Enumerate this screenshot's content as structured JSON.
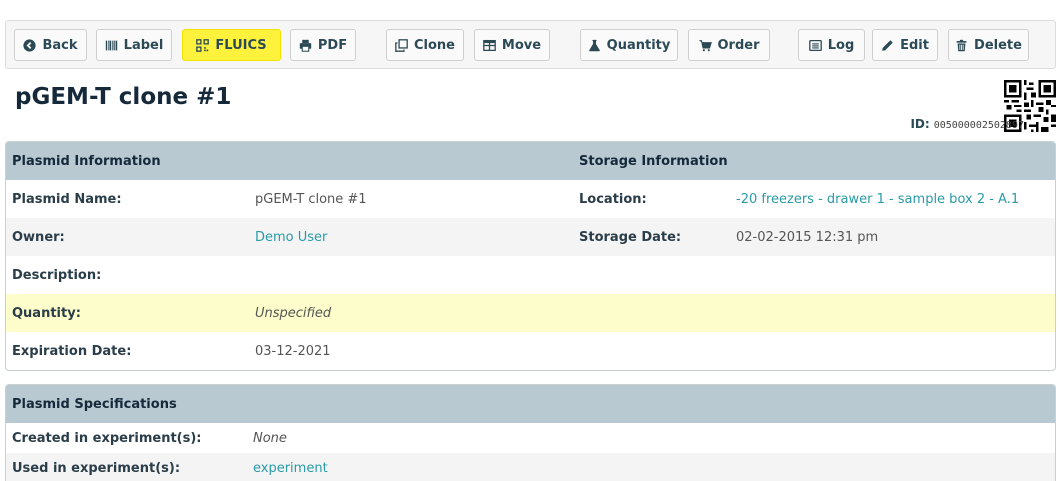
{
  "toolbar": {
    "back": "Back",
    "label": "Label",
    "fluics": "FLUICS",
    "pdf": "PDF",
    "clone": "Clone",
    "move": "Move",
    "quantity": "Quantity",
    "order": "Order",
    "log": "Log",
    "edit": "Edit",
    "delete": "Delete"
  },
  "page": {
    "title": "pGEM-T clone #1",
    "id_label": "ID:",
    "id_value": "005000002502897"
  },
  "plasmid_info": {
    "heading": "Plasmid Information",
    "storage_heading": "Storage Information",
    "name_label": "Plasmid Name:",
    "name_value": "pGEM-T clone #1",
    "owner_label": "Owner:",
    "owner_value": "Demo User",
    "description_label": "Description:",
    "quantity_label": "Quantity:",
    "quantity_value": "Unspecified",
    "expiration_label": "Expiration Date:",
    "expiration_value": "03-12-2021",
    "location_label": "Location:",
    "location_value": "-20 freezers - drawer 1 - sample box 2 - A.1",
    "storage_date_label": "Storage Date:",
    "storage_date_value": "02-02-2015 12:31 pm"
  },
  "specs": {
    "heading": "Plasmid Specifications",
    "created_label": "Created in experiment(s):",
    "created_value": "None",
    "used_label": "Used in experiment(s):",
    "used_value": "experiment"
  },
  "colors": {
    "accent_link": "#2a9aa6",
    "highlight_button": "#fff23d",
    "panel_header": "#b8c9d1",
    "highlight_row": "#fdfdcc"
  }
}
